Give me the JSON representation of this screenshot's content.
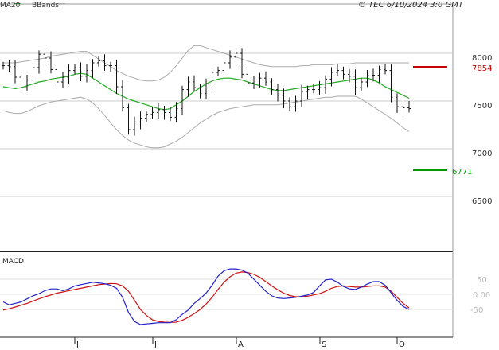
{
  "header": {
    "legend_ma": "MA20",
    "legend_bbands": "BBands",
    "copyright": "© TEC 6/10/2024 3:0 GMT"
  },
  "levels": {
    "resistance": {
      "value": 7854,
      "label": "7854",
      "color": "#cc0000"
    },
    "support": {
      "value": 6771,
      "label": "6771",
      "color": "#009900"
    }
  },
  "macd_panel": {
    "title": "MACD"
  },
  "colors": {
    "ma": "#22aa22",
    "bbands": "#aaaaaa",
    "bars": "#111111",
    "macd": "#2222cc",
    "signal": "#cc1111"
  },
  "chart_data": [
    {
      "type": "ohlc",
      "x_labels": [
        "J",
        "J",
        "A",
        "S",
        "O"
      ],
      "ylim": [
        6000,
        8400
      ],
      "yticks": [
        6500,
        7000,
        7500,
        8000
      ],
      "ytick_labels": [
        "6500",
        "7000",
        "7500",
        "8000"
      ],
      "series": [
        {
          "name": "MA20",
          "values": [
            7650,
            7640,
            7630,
            7640,
            7660,
            7680,
            7700,
            7710,
            7730,
            7740,
            7750,
            7760,
            7780,
            7790,
            7780,
            7740,
            7700,
            7660,
            7620,
            7580,
            7550,
            7520,
            7500,
            7480,
            7460,
            7440,
            7420,
            7410,
            7420,
            7460,
            7500,
            7550,
            7600,
            7640,
            7680,
            7710,
            7730,
            7740,
            7740,
            7730,
            7720,
            7700,
            7680,
            7660,
            7640,
            7620,
            7610,
            7610,
            7620,
            7630,
            7640,
            7650,
            7660,
            7670,
            7680,
            7690,
            7700,
            7710,
            7720,
            7730,
            7740,
            7740,
            7720,
            7690,
            7650,
            7620,
            7590,
            7560,
            7530
          ]
        },
        {
          "name": "BBands upper",
          "values": [
            7900,
            7900,
            7900,
            7910,
            7920,
            7930,
            7940,
            7950,
            7970,
            7980,
            7990,
            8000,
            8010,
            8020,
            8020,
            7980,
            7940,
            7900,
            7860,
            7820,
            7790,
            7760,
            7740,
            7720,
            7710,
            7710,
            7720,
            7750,
            7800,
            7870,
            7950,
            8030,
            8080,
            8080,
            8060,
            8040,
            8020,
            8000,
            7980,
            7960,
            7940,
            7920,
            7900,
            7880,
            7870,
            7860,
            7860,
            7860,
            7860,
            7860,
            7870,
            7870,
            7880,
            7880,
            7880,
            7880,
            7890,
            7890,
            7890,
            7900,
            7900,
            7900,
            7900,
            7900,
            7900,
            7900,
            7900,
            7900,
            7900
          ]
        },
        {
          "name": "BBands lower",
          "values": [
            7400,
            7380,
            7370,
            7370,
            7390,
            7420,
            7450,
            7470,
            7490,
            7500,
            7510,
            7520,
            7530,
            7540,
            7520,
            7480,
            7420,
            7350,
            7270,
            7200,
            7140,
            7090,
            7060,
            7040,
            7020,
            7010,
            7010,
            7020,
            7050,
            7080,
            7120,
            7170,
            7220,
            7270,
            7310,
            7350,
            7380,
            7400,
            7420,
            7430,
            7440,
            7450,
            7460,
            7460,
            7460,
            7460,
            7460,
            7470,
            7480,
            7490,
            7500,
            7510,
            7520,
            7530,
            7540,
            7540,
            7550,
            7550,
            7550,
            7550,
            7520,
            7480,
            7440,
            7400,
            7360,
            7320,
            7270,
            7220,
            7180
          ]
        },
        {
          "name": "Price",
          "values": [
            7870,
            7860,
            7750,
            7640,
            7720,
            7850,
            7990,
            7950,
            7830,
            7700,
            7750,
            7820,
            7850,
            7760,
            7820,
            7900,
            7920,
            7870,
            7870,
            7650,
            7430,
            7200,
            7280,
            7320,
            7360,
            7380,
            7410,
            7380,
            7330,
            7420,
            7620,
            7700,
            7640,
            7580,
            7680,
            7800,
            7820,
            7900,
            7960,
            8000,
            7780,
            7690,
            7720,
            7740,
            7700,
            7620,
            7560,
            7500,
            7440,
            7500,
            7600,
            7620,
            7620,
            7640,
            7730,
            7800,
            7820,
            7780,
            7760,
            7640,
            7700,
            7770,
            7770,
            7830,
            7820,
            7540,
            7440,
            7430,
            7420
          ]
        }
      ]
    },
    {
      "type": "line",
      "title": "MACD",
      "ylim": [
        -110,
        90
      ],
      "yticks": [
        50,
        0,
        -50
      ],
      "ytick_labels": [
        "50",
        "0.00",
        "-50"
      ],
      "series": [
        {
          "name": "MACD",
          "values": [
            -25,
            -35,
            -30,
            -25,
            -15,
            -5,
            2,
            12,
            18,
            18,
            12,
            18,
            28,
            32,
            36,
            40,
            38,
            35,
            30,
            20,
            -10,
            -60,
            -90,
            -100,
            -98,
            -96,
            -94,
            -94,
            -94,
            -84,
            -66,
            -52,
            -30,
            -14,
            4,
            30,
            60,
            78,
            84,
            84,
            80,
            70,
            50,
            30,
            10,
            -5,
            -12,
            -14,
            -12,
            -10,
            -6,
            -2,
            6,
            28,
            48,
            50,
            40,
            26,
            18,
            16,
            24,
            34,
            42,
            42,
            30,
            5,
            -20,
            -40,
            -50
          ]
        },
        {
          "name": "Signal",
          "values": [
            -52,
            -48,
            -42,
            -36,
            -30,
            -22,
            -15,
            -8,
            -2,
            4,
            8,
            12,
            16,
            20,
            24,
            28,
            32,
            34,
            36,
            35,
            28,
            10,
            -20,
            -50,
            -70,
            -84,
            -90,
            -92,
            -93,
            -92,
            -86,
            -76,
            -64,
            -50,
            -32,
            -10,
            16,
            40,
            58,
            70,
            74,
            72,
            66,
            56,
            42,
            28,
            15,
            4,
            -4,
            -8,
            -8,
            -6,
            -2,
            2,
            10,
            20,
            26,
            28,
            26,
            24,
            24,
            26,
            28,
            28,
            24,
            10,
            -10,
            -30,
            -45
          ]
        }
      ]
    }
  ]
}
